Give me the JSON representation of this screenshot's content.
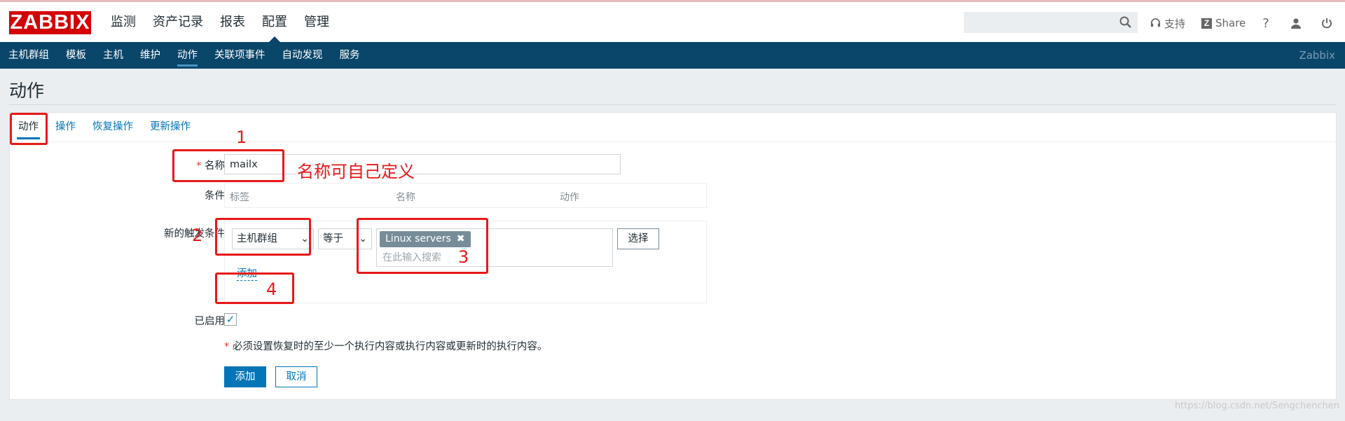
{
  "header": {
    "logo": "ZABBIX",
    "menu": [
      {
        "label": "监测",
        "active": false
      },
      {
        "label": "资产记录",
        "active": false
      },
      {
        "label": "报表",
        "active": false
      },
      {
        "label": "配置",
        "active": true
      },
      {
        "label": "管理",
        "active": false
      }
    ],
    "search": {
      "value": "",
      "placeholder": ""
    },
    "support_label": "支持",
    "share_label": "Share",
    "help_icon": "help-icon",
    "user_icon": "user-icon",
    "logout_icon": "power-icon"
  },
  "subnav": {
    "items": [
      {
        "label": "主机群组",
        "active": false
      },
      {
        "label": "模板",
        "active": false
      },
      {
        "label": "主机",
        "active": false
      },
      {
        "label": "维护",
        "active": false
      },
      {
        "label": "动作",
        "active": true
      },
      {
        "label": "关联项事件",
        "active": false
      },
      {
        "label": "自动发现",
        "active": false
      },
      {
        "label": "服务",
        "active": false
      }
    ],
    "brand": "Zabbix"
  },
  "page": {
    "title": "动作"
  },
  "tabs": [
    {
      "label": "动作",
      "active": true
    },
    {
      "label": "操作",
      "active": false
    },
    {
      "label": "恢复操作",
      "active": false
    },
    {
      "label": "更新操作",
      "active": false
    }
  ],
  "form": {
    "name_label": "名称",
    "name_required": "*",
    "name_value": "mailx",
    "conditions_label": "条件",
    "conditions_columns": [
      "标签",
      "名称",
      "动作"
    ],
    "new_condition_label": "新的触发条件",
    "condition_type": "主机群组",
    "condition_operator": "等于",
    "selected_values": [
      "Linux servers"
    ],
    "search_placeholder": "在此输入搜索",
    "select_button": "选择",
    "add_link": "添加",
    "enabled_label": "已启用",
    "enabled": true,
    "note_star": "*",
    "note": "必须设置恢复时的至少一个执行内容或执行内容或更新时的执行内容。",
    "submit_button": "添加",
    "cancel_button": "取消"
  },
  "annotations": {
    "n1": "1",
    "n2": "2",
    "n3": "3",
    "n4": "4",
    "name_hint": "名称可自己定义"
  },
  "watermark": "https://blog.csdn.net/Sengchenchen",
  "colors": {
    "brand_red": "#d40000",
    "nav_blue": "#0a466a",
    "link_blue": "#0275b8",
    "annotation_red": "#e81818"
  }
}
